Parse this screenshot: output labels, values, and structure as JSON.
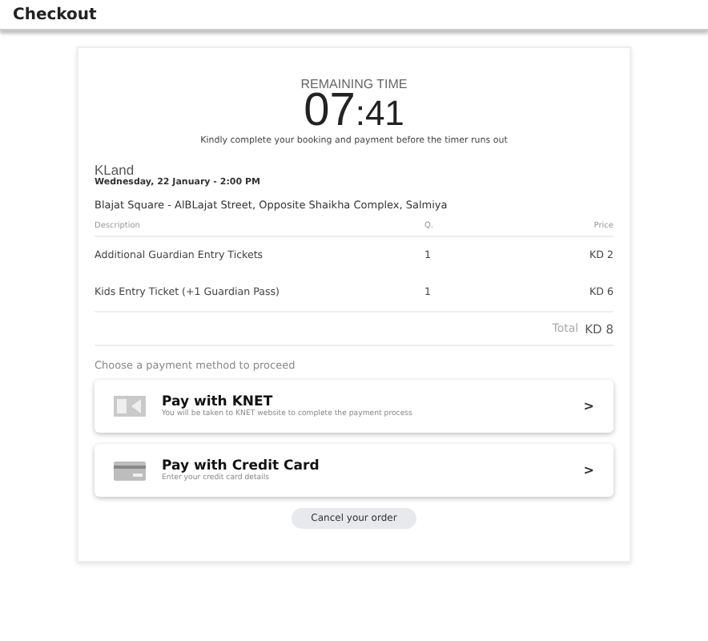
{
  "header": {
    "title": "Checkout"
  },
  "timer": {
    "label": "REMAINING TIME",
    "minutes": "07",
    "seconds": ":41",
    "note": "Kindly complete your booking and payment before the timer runs out"
  },
  "event": {
    "name": "KLand",
    "date": "Wednesday, 22 January - 2:00 PM",
    "venue": "Blajat Square - AlBLajat Street, Opposite Shaikha Complex, Salmiya"
  },
  "table": {
    "columns": [
      "Description",
      "Q.",
      "Price"
    ],
    "rows": [
      {
        "description": "Additional Guardian Entry Tickets",
        "quantity": "1",
        "price": "KD 2"
      },
      {
        "description": "Kids Entry Ticket (+1 Guardian Pass)",
        "quantity": "1",
        "price": "KD 6"
      }
    ],
    "total_label": "Total",
    "total": "KD 8"
  },
  "payment": {
    "prompt": "Choose a payment method to proceed",
    "methods": [
      {
        "kind": "knet",
        "title": "Pay with KNET",
        "subtitle": "You will be taken to KNET website to complete the payment process",
        "chevron": ">"
      },
      {
        "kind": "card",
        "title": "Pay with Credit Card",
        "subtitle": "Enter your credit card details",
        "chevron": ">"
      }
    ]
  },
  "cancel_button": "Cancel your order"
}
